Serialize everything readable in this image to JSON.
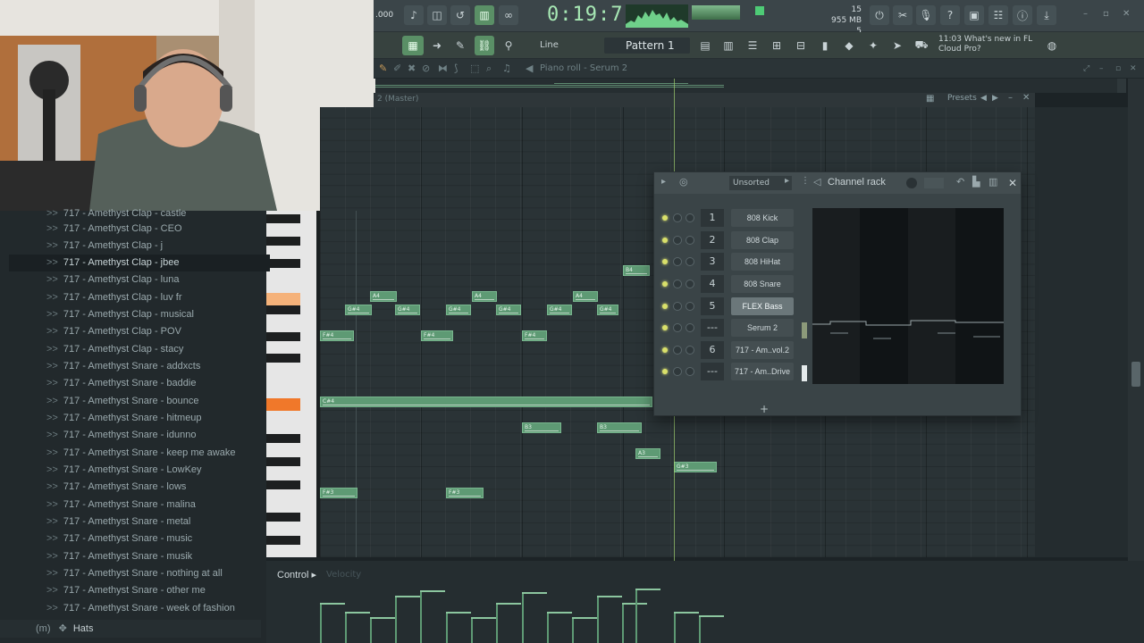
{
  "toolbar": {
    "bpm": ".000",
    "time": "0:19:71",
    "cpu_line1": "15",
    "cpu_line2": "955 MB",
    "cpu_line3": "5",
    "pattern_label": "Pattern 1",
    "snap_label": "Line",
    "news_line1": "11:03  What's new in FL",
    "news_line2": "Cloud Pro?"
  },
  "piano_roll": {
    "title": "Piano roll - Serum 2",
    "header_label": "2 (Master)",
    "presets_label": "Presets",
    "notes": [
      {
        "label": "B4"
      },
      {
        "label": "A4"
      },
      {
        "label": "A4"
      },
      {
        "label": "A4"
      },
      {
        "label": "G#4"
      },
      {
        "label": "G#4"
      },
      {
        "label": "G#4"
      },
      {
        "label": "G#4"
      },
      {
        "label": "G#4"
      },
      {
        "label": "G#4"
      },
      {
        "label": "F#4"
      },
      {
        "label": "F#4"
      },
      {
        "label": "F#4"
      },
      {
        "label": "C#4"
      },
      {
        "label": "B3"
      },
      {
        "label": "B3"
      },
      {
        "label": "A3"
      },
      {
        "label": "G#3"
      },
      {
        "label": "F#3"
      },
      {
        "label": "F#3"
      }
    ]
  },
  "control": {
    "label": "Control",
    "velocity_label": "Velocity"
  },
  "browser": {
    "items": [
      "717 - Amethyst Clap - castle",
      "717 - Amethyst Clap - CEO",
      "717 - Amethyst Clap - j",
      "717 - Amethyst Clap - jbee",
      "717 - Amethyst Clap - luna",
      "717 - Amethyst Clap - luv fr",
      "717 - Amethyst Clap - musical",
      "717 - Amethyst Clap - POV",
      "717 - Amethyst Clap - stacy",
      "717 - Amethyst Snare - addxcts",
      "717 - Amethyst Snare - baddie",
      "717 - Amethyst Snare - bounce",
      "717 - Amethyst Snare - hitmeup",
      "717 - Amethyst Snare - idunno",
      "717 - Amethyst Snare - keep me awake",
      "717 - Amethyst Snare - LowKey",
      "717 - Amethyst Snare - lows",
      "717 - Amethyst Snare - malina",
      "717 - Amethyst Snare - metal",
      "717 - Amethyst Snare - music",
      "717 - Amethyst Snare - musik",
      "717 - Amethyst Snare - nothing at all",
      "717 - Amethyst Snare - other me",
      "717 - Amethyst Snare - week of fashion"
    ],
    "selected_index": 3,
    "folder_label": "Hats",
    "folder_prefix": "(m)"
  },
  "channel_rack": {
    "title": "Channel rack",
    "sort_label": "Unsorted",
    "channels": [
      {
        "num": "1",
        "name": "808 Kick",
        "selected": false
      },
      {
        "num": "2",
        "name": "808 Clap",
        "selected": false
      },
      {
        "num": "3",
        "name": "808 HiHat",
        "selected": false
      },
      {
        "num": "4",
        "name": "808 Snare",
        "selected": false
      },
      {
        "num": "5",
        "name": "FLEX Bass",
        "selected": true
      },
      {
        "num": "---",
        "name": "Serum 2",
        "selected": false
      },
      {
        "num": "6",
        "name": "717 - Am..vol.2",
        "selected": false
      },
      {
        "num": "---",
        "name": "717 - Am..Drive",
        "selected": false
      }
    ]
  },
  "colors": {
    "note": "#5e9a74",
    "accent_green": "#a7e8b4",
    "key_highlight": "#f5b27a"
  }
}
